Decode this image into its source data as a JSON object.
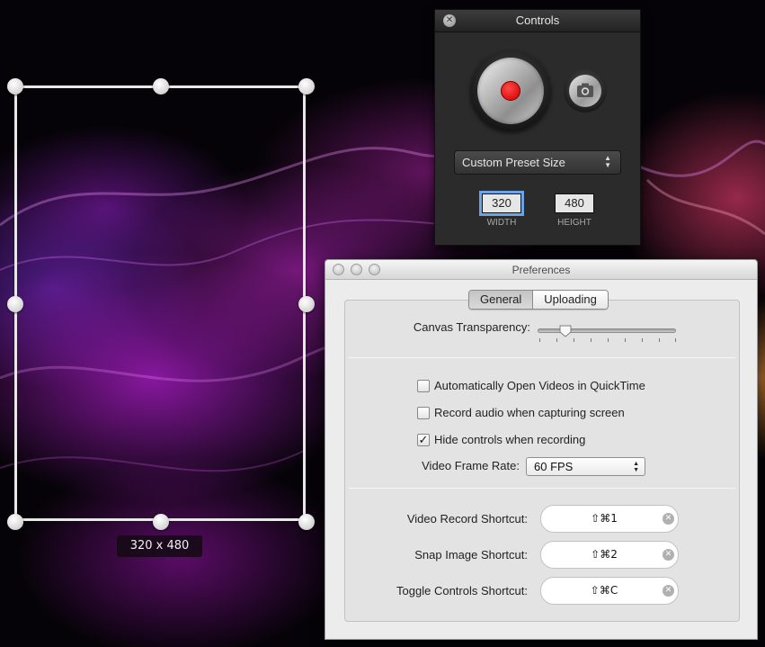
{
  "selection": {
    "size_label": "320 x 480"
  },
  "controls": {
    "title": "Controls",
    "record_color": "#e01010",
    "preset": "Custom Preset Size",
    "width_value": "320",
    "height_value": "480",
    "width_label": "WIDTH",
    "height_label": "HEIGHT"
  },
  "preferences": {
    "title": "Preferences",
    "tabs": [
      {
        "label": "General",
        "selected": true
      },
      {
        "label": "Uploading",
        "selected": false
      }
    ],
    "canvas_transparency_label": "Canvas Transparency:",
    "canvas_transparency_level": 0.2,
    "checkboxes": [
      {
        "label": "Automatically Open Videos in QuickTime",
        "checked": false
      },
      {
        "label": "Record audio when capturing screen",
        "checked": false
      },
      {
        "label": "Hide controls when recording",
        "checked": true
      }
    ],
    "frame_rate_label": "Video Frame Rate:",
    "frame_rate_value": "60 FPS",
    "shortcuts": [
      {
        "label": "Video Record Shortcut:",
        "keys": "⇧⌘1"
      },
      {
        "label": "Snap Image Shortcut:",
        "keys": "⇧⌘2"
      },
      {
        "label": "Toggle Controls Shortcut:",
        "keys": "⇧⌘C"
      }
    ]
  }
}
